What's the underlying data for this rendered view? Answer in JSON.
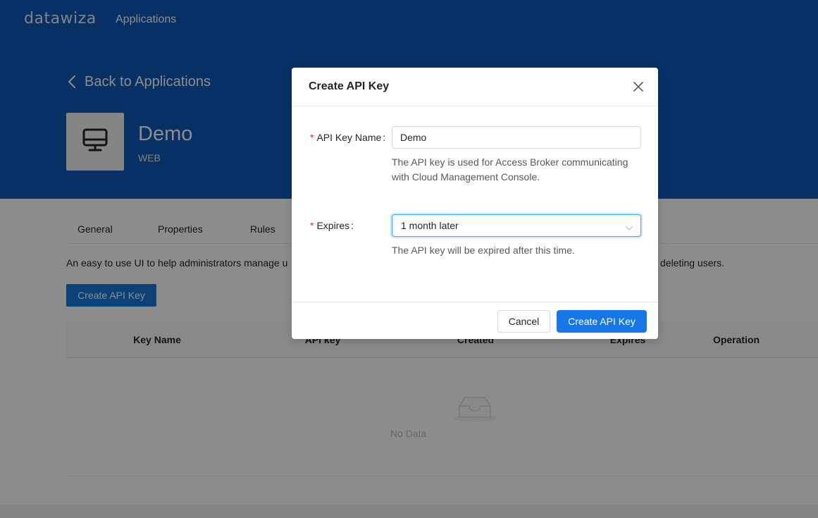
{
  "topbar": {
    "logo": "datawiza",
    "nav_applications": "Applications"
  },
  "app_header": {
    "back_label": "Back to Applications",
    "app_name": "Demo",
    "app_type": "WEB",
    "app_icon": "desktop-icon"
  },
  "tabs": [
    {
      "label": "General"
    },
    {
      "label": "Properties"
    },
    {
      "label": "Rules"
    }
  ],
  "page": {
    "description_start": "An easy to use UI to help administrators manage u",
    "description_end": "deleting users.",
    "create_button": "Create API Key"
  },
  "table": {
    "columns": [
      "Key Name",
      "API key",
      "Created",
      "Expires",
      "Operation"
    ],
    "empty_text": "No Data",
    "empty_icon": "inbox-icon"
  },
  "modal": {
    "title": "Create API Key",
    "close_icon": "close-icon",
    "fields": {
      "name": {
        "label": "API Key Name",
        "value": "Demo",
        "help": "The API key is used for Access Broker communicating with Cloud Management Console."
      },
      "expires": {
        "label": "Expires",
        "value": "1 month later",
        "help": "The API key will be expired after this time."
      }
    },
    "cancel_label": "Cancel",
    "ok_label": "Create API Key"
  },
  "colors": {
    "header_blue": "#0e59b8",
    "primary": "#1677e6",
    "required": "#f5222d"
  }
}
